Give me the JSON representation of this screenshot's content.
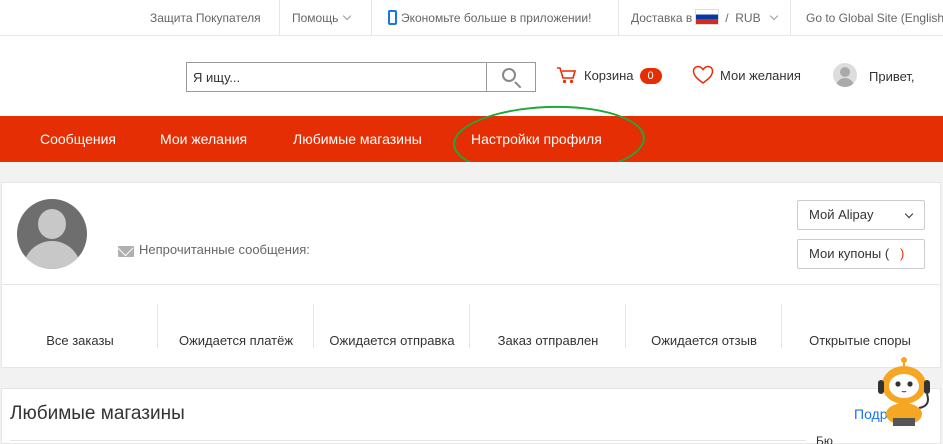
{
  "topbar": {
    "buyer_protection": "Защита Покупателя",
    "help": "Помощь",
    "app_promo": "Экономьте больше в приложении!",
    "ship_to": "Доставка в",
    "currency": "RUB",
    "slash": "/",
    "global_site": "Go to Global Site (English"
  },
  "search": {
    "placeholder": "Я ищу..."
  },
  "header": {
    "cart_label": "Корзина",
    "cart_count": "0",
    "wishlist_label": "Мои желания",
    "greeting": "Привет,"
  },
  "nav": {
    "items": [
      {
        "label": "Сообщения"
      },
      {
        "label": "Мои желания"
      },
      {
        "label": "Любимые магазины"
      },
      {
        "label": "Настройки профиля"
      }
    ]
  },
  "profile": {
    "unread_label": "Непрочитанные сообщения:",
    "alipay_button": "Мой Alipay",
    "coupons_label": "Мои купоны (",
    "coupons_close": ")"
  },
  "orders": {
    "tabs": [
      {
        "label": "Все заказы"
      },
      {
        "label": "Ожидается платёж"
      },
      {
        "label": "Ожидается отправка"
      },
      {
        "label": "Заказ отправлен"
      },
      {
        "label": "Ожидается отзыв"
      },
      {
        "label": "Открытые споры"
      }
    ]
  },
  "favorites": {
    "title": "Любимые магазины",
    "link": "Подр",
    "cut_text": "Бю"
  },
  "colors": {
    "accent": "#e62e04",
    "annotation": "#1fa83b",
    "link": "#1a73e8"
  },
  "icons": [
    "phone-icon",
    "russia-flag-icon",
    "search-icon",
    "cart-icon",
    "heart-icon",
    "user-avatar-icon",
    "mail-icon",
    "chevron-down-icon",
    "robot-assistant-icon"
  ]
}
